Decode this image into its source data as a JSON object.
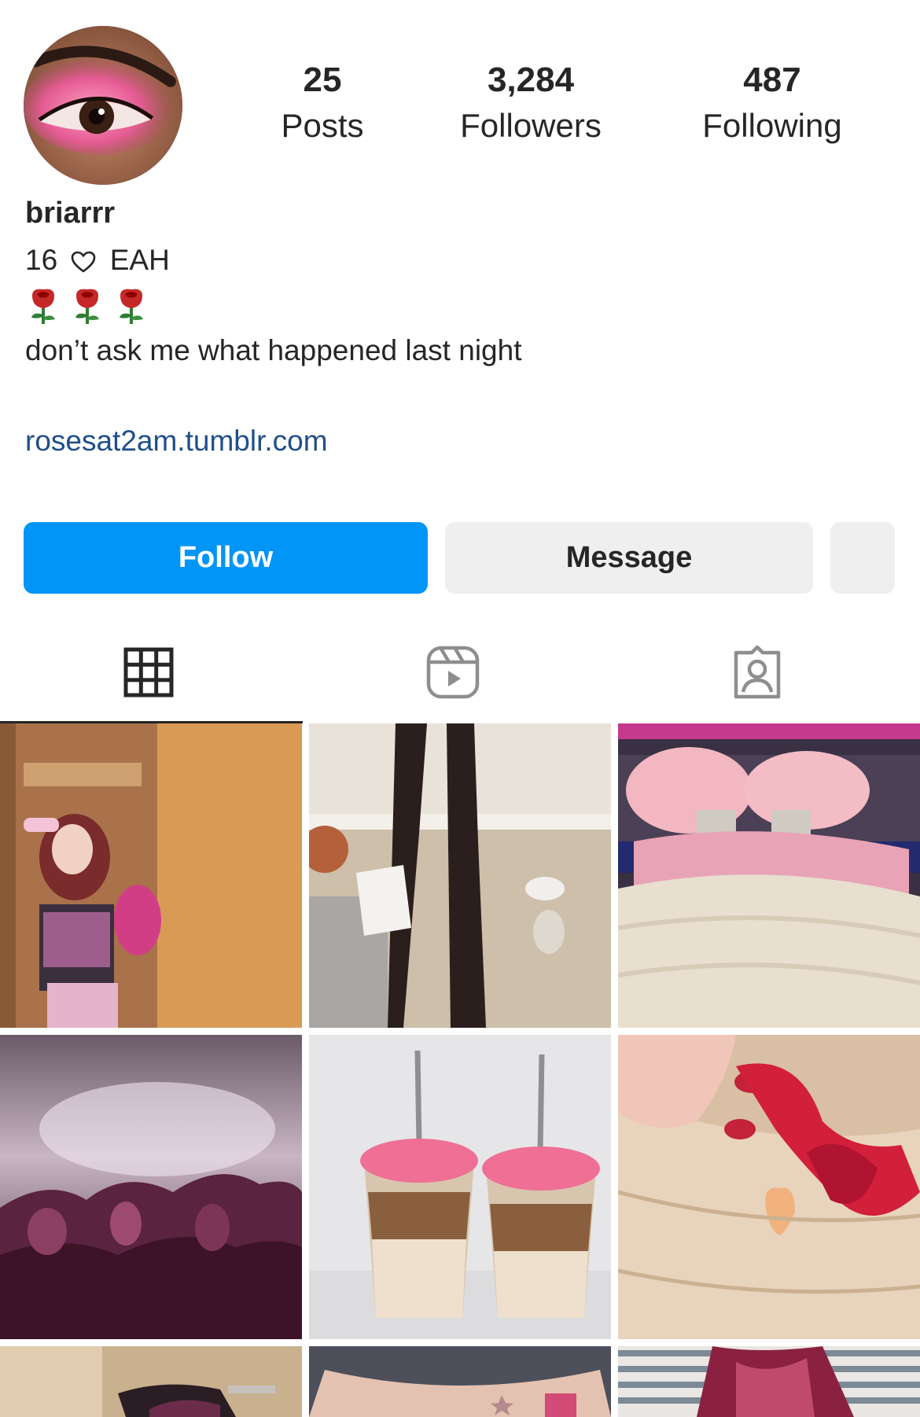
{
  "profile": {
    "username": "briarrr",
    "avatar_icon": "pink-eyeshadow-eye-avatar",
    "stats": {
      "posts": {
        "value": "25",
        "label": "Posts"
      },
      "followers": {
        "value": "3,284",
        "label": "Followers"
      },
      "following": {
        "value": "487",
        "label": "Following"
      }
    },
    "bio": {
      "age_part": "16",
      "heart_icon": "heart-outline-icon",
      "initials": "EAH",
      "emoji_line": "🌹🌹🌹",
      "tagline": "don’t ask me what happened last night"
    },
    "link": "rosesat2am.tumblr.com"
  },
  "actions": {
    "follow_label": "Follow",
    "message_label": "Message",
    "more_icon": "more-options-icon"
  },
  "tabs": [
    {
      "name": "posts",
      "icon": "grid-icon",
      "active": true
    },
    {
      "name": "reels",
      "icon": "reels-icon",
      "active": false
    },
    {
      "name": "tagged",
      "icon": "tagged-icon",
      "active": false
    }
  ],
  "colors": {
    "accent": "#0095f6",
    "link": "#1f4f88",
    "secondary_button": "#efefef",
    "text": "#262626"
  },
  "posts": [
    {
      "subject": "girl-in-pink-outfit-mirror"
    },
    {
      "subject": "lace-tights-legs-on-floor"
    },
    {
      "subject": "pink-fluffy-slippers"
    },
    {
      "subject": "blurry-concert-crowd"
    },
    {
      "subject": "pink-iced-coffees"
    },
    {
      "subject": "red-bow-in-blonde-hair"
    },
    {
      "subject": "sunglasses-closeup"
    },
    {
      "subject": "jeans-with-tattoo"
    },
    {
      "subject": "striped-shirt-pink-hair"
    }
  ]
}
